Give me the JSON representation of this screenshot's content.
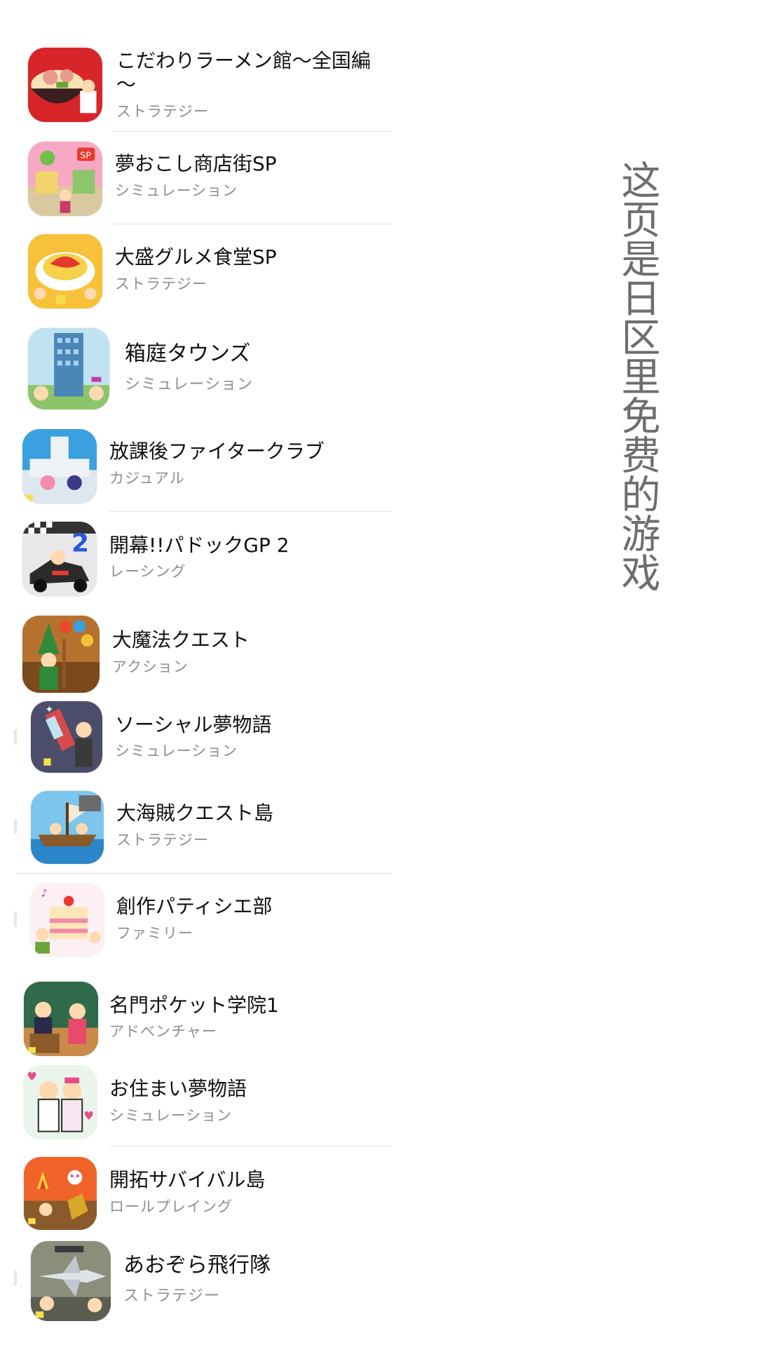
{
  "note": "这页是日区里免费的游戏",
  "apps": [
    {
      "title": "こだわりラーメン館～全国編～",
      "genre": "ストラテジー"
    },
    {
      "title": "夢おこし商店街SP",
      "genre": "シミュレーション"
    },
    {
      "title": "大盛グルメ食堂SP",
      "genre": "ストラテジー"
    },
    {
      "title": "箱庭タウンズ",
      "genre": "シミュレーション"
    },
    {
      "title": "放課後ファイタークラブ",
      "genre": "カジュアル"
    },
    {
      "title": "開幕!!パドックGP 2",
      "genre": "レーシング"
    },
    {
      "title": "大魔法クエスト",
      "genre": "アクション"
    },
    {
      "title": "ソーシャル夢物語",
      "genre": "シミュレーション"
    },
    {
      "title": "大海賊クエスト島",
      "genre": "ストラテジー"
    },
    {
      "title": "創作パティシエ部",
      "genre": "ファミリー"
    },
    {
      "title": "名門ポケット学院1",
      "genre": "アドベンチャー"
    },
    {
      "title": "お住まい夢物語",
      "genre": "シミュレーション"
    },
    {
      "title": "開拓サバイバル島",
      "genre": "ロールプレイング"
    },
    {
      "title": "あおぞら飛行隊",
      "genre": "ストラテジー"
    }
  ],
  "icon_names": [
    "ramen-icon",
    "shopping-street-icon",
    "omelette-icon",
    "building-icon",
    "school-icon",
    "racecar-icon",
    "wizard-icon",
    "phone-icon",
    "pirate-ship-icon",
    "cake-icon",
    "classroom-icon",
    "couple-icon",
    "campfire-icon",
    "jet-icon"
  ],
  "colors": {
    "title": "#111111",
    "genre": "#8e8e93",
    "note": "#6d6d72",
    "separator": "#e3e3e6"
  }
}
